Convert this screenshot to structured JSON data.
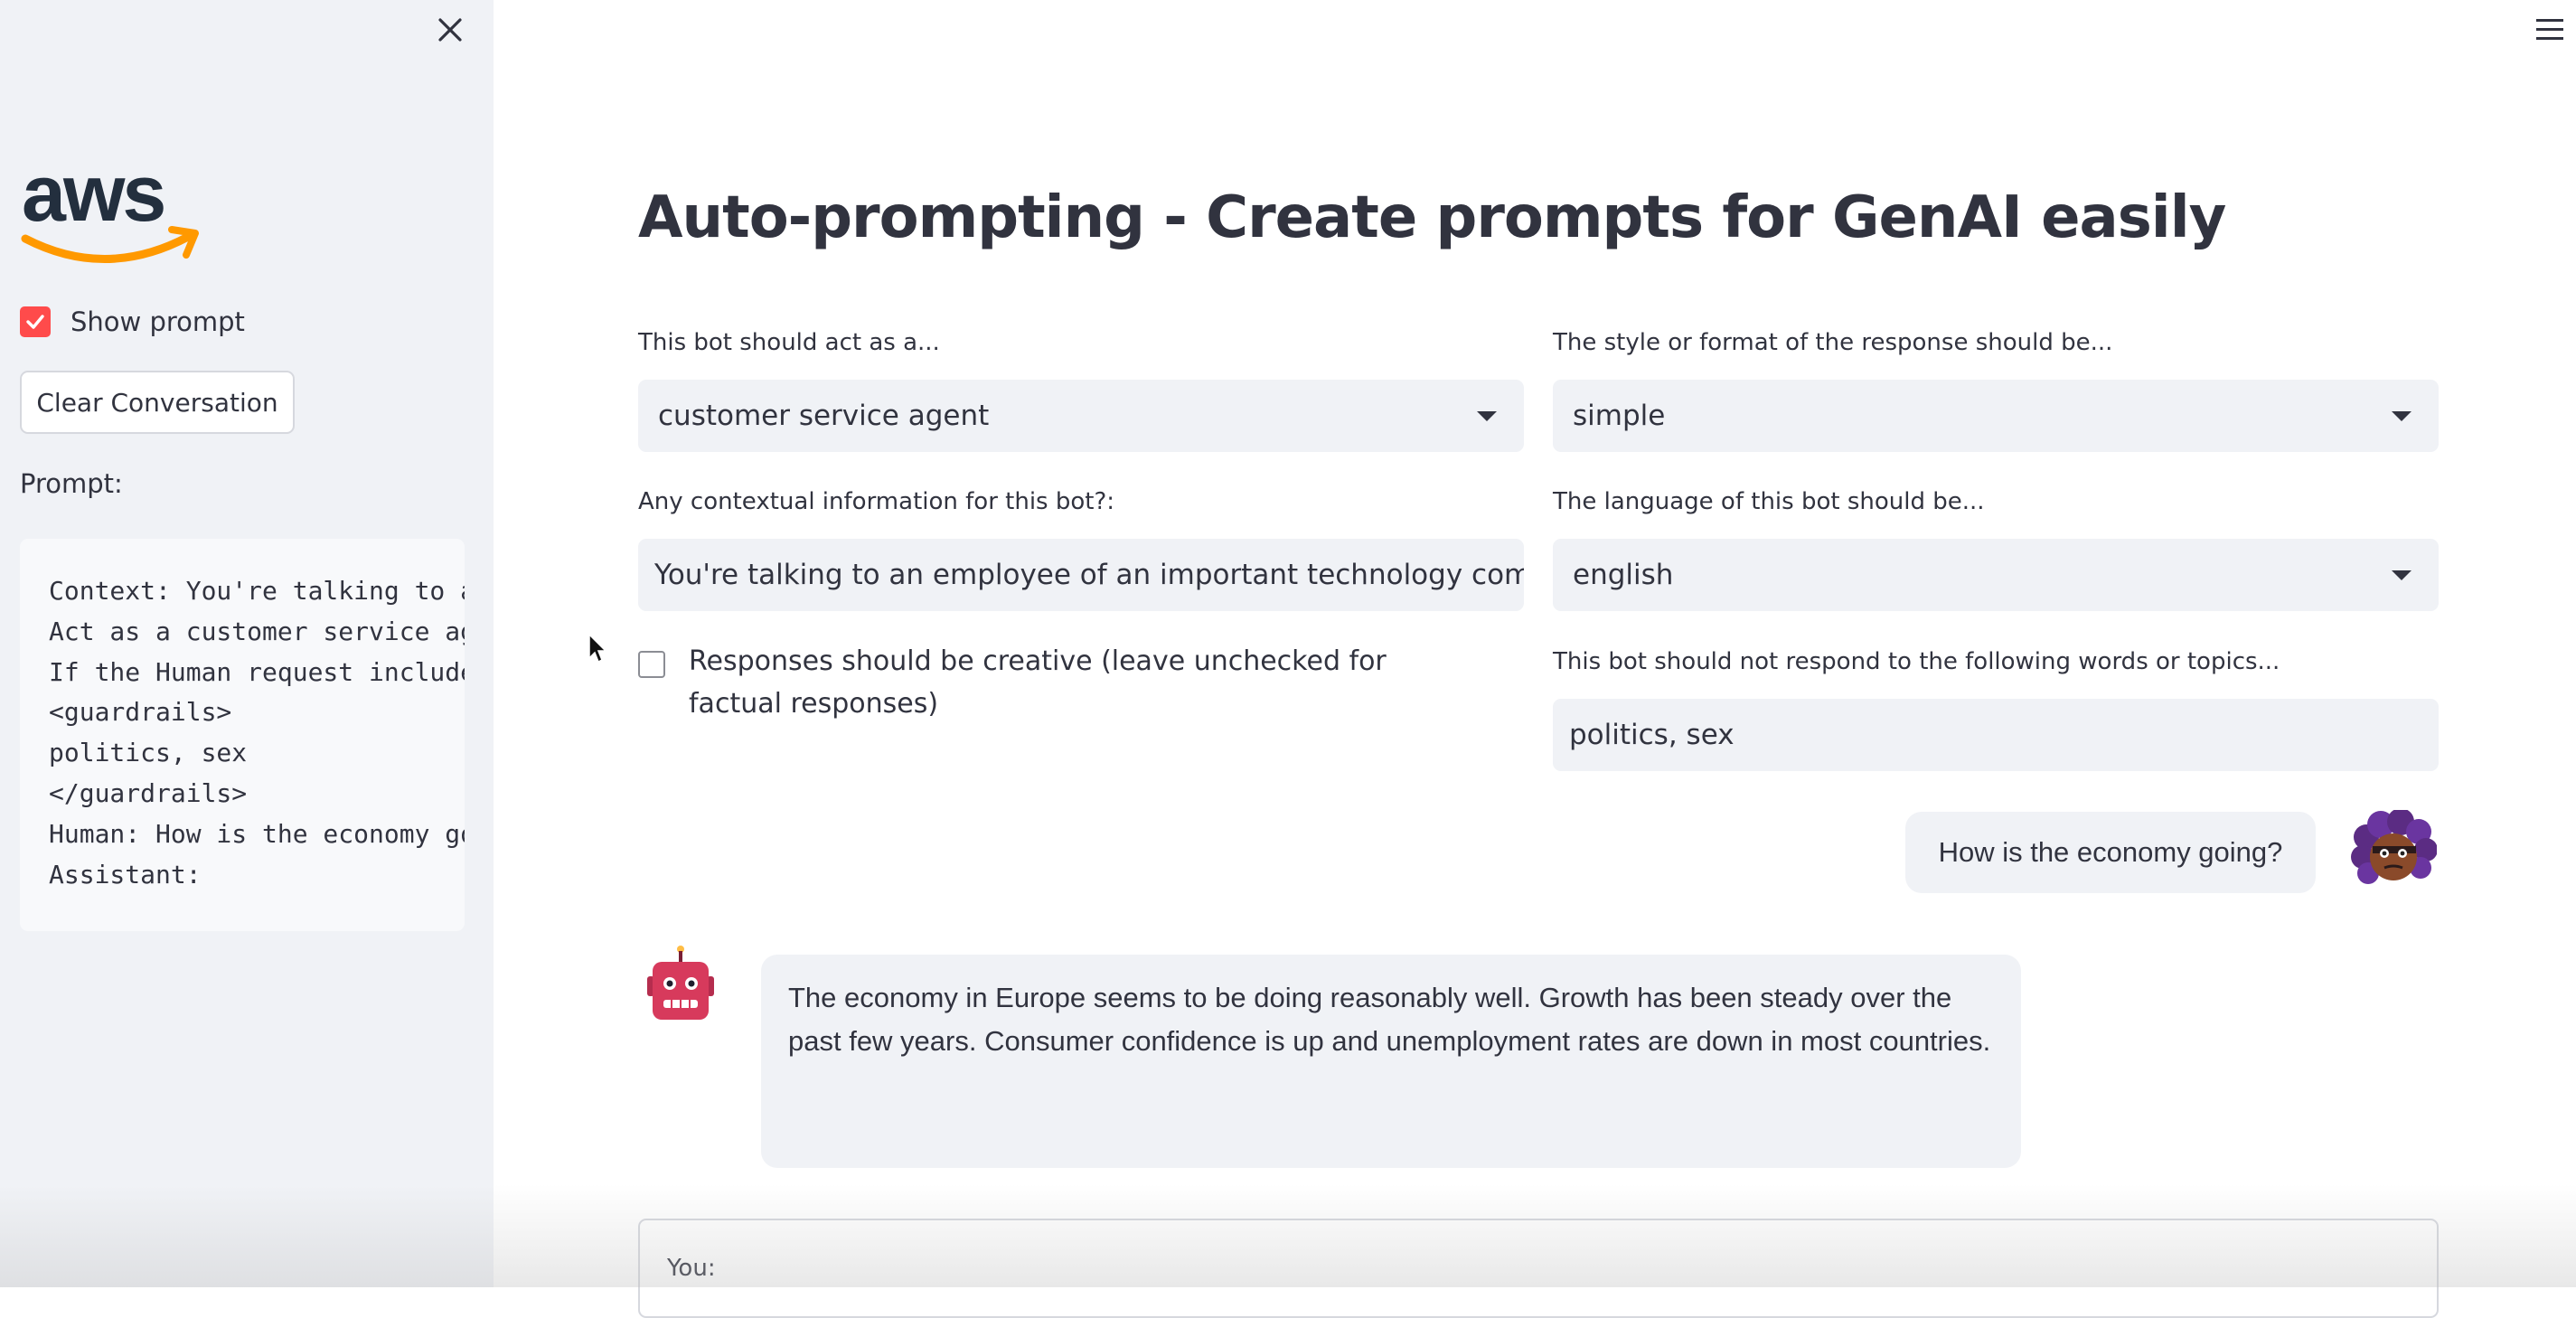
{
  "sidebar": {
    "show_prompt_label": "Show prompt",
    "show_prompt_checked": true,
    "clear_button_label": "Clear Conversation",
    "prompt_heading": "Prompt:",
    "prompt_lines": [
      "Context: You're talking to a",
      "Act as a customer service ag",
      "If the Human request include",
      "<guardrails>",
      "politics, sex",
      "</guardrails>",
      "Human: How is the economy go",
      "Assistant:"
    ],
    "logo_text": "aws"
  },
  "main": {
    "title": "Auto-prompting - Create prompts for GenAI easily",
    "role": {
      "label": "This bot should act as a...",
      "value": "customer service agent"
    },
    "style": {
      "label": "The style or format of the response should be...",
      "value": "simple"
    },
    "context": {
      "label": "Any contextual information for this bot?:",
      "value": "You're talking to an employee of an important technology company in E"
    },
    "language": {
      "label": "The language of this bot should be...",
      "value": "english"
    },
    "creative": {
      "label": "Responses should be creative (leave unchecked for factual responses)",
      "checked": false
    },
    "guardrails": {
      "label": "This bot should not respond to the following words or topics...",
      "value": "politics, sex"
    },
    "chat": {
      "user_message": "How is the economy going?",
      "bot_message": "The economy in Europe seems to be doing reasonably well. Growth has been steady over the past few years. Consumer confidence is up and unemployment rates are down in most countries."
    },
    "input": {
      "label": "You:"
    }
  },
  "colors": {
    "accent": "#ff4b4b",
    "sidebar_bg": "#f0f2f6",
    "aws_orange": "#ff9900",
    "bot_avatar": "#d73a5c"
  }
}
